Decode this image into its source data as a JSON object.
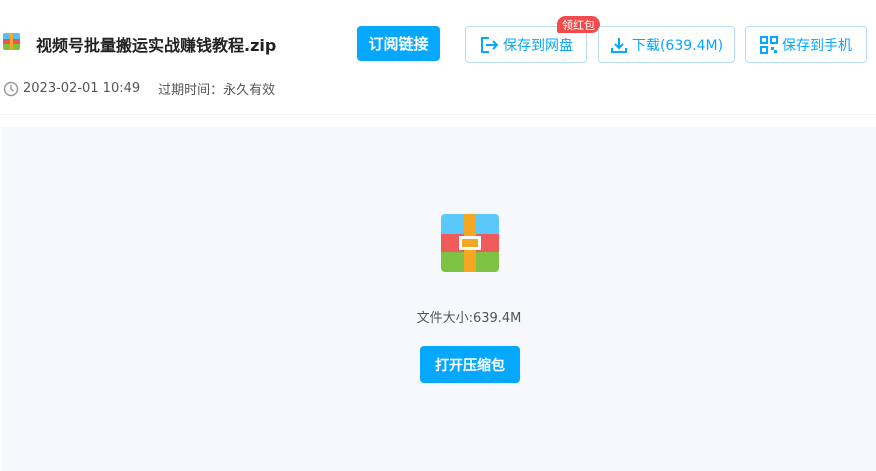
{
  "file": {
    "name": "视频号批量搬运实战赚钱教程.zip",
    "date": "2023-02-01 10:49",
    "expire": "过期时间：永久有效",
    "size_text": "文件大小:639.4M"
  },
  "actions": {
    "subscribe_label": "订阅链接",
    "save_label": "保存到网盘",
    "save_badge": "领红包",
    "download_label": "下载(639.4M)",
    "phone_label": "保存到手机"
  },
  "preview": {
    "open_label": "打开压缩包"
  },
  "colors": {
    "accent": "#06a7ff",
    "badge": "#f24b4b",
    "preview_bg": "#f6f8fc"
  },
  "icons": [
    "zip-file-icon",
    "save-to-cloud-icon",
    "download-icon",
    "qr-code-icon",
    "clock-icon"
  ]
}
